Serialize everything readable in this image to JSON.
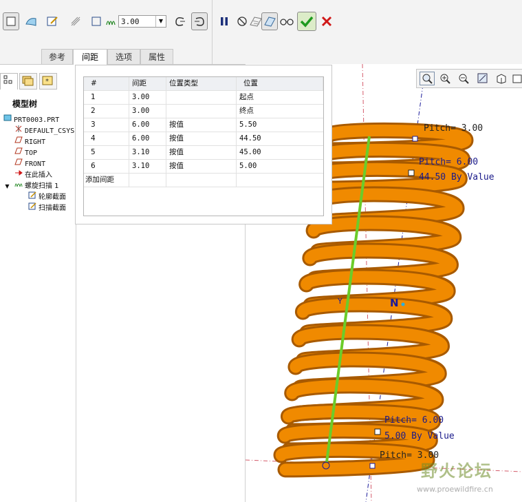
{
  "ribbon": {
    "pitch_value": "3.00",
    "tabs": [
      "参考",
      "间距",
      "选项",
      "属性"
    ],
    "active_tab": "间距"
  },
  "left_panel": {
    "tree_title": "模型树",
    "tree_items": [
      {
        "icon": "part-icon",
        "label": "PRT0003.PRT"
      },
      {
        "icon": "csys-icon",
        "label": "DEFAULT_CSYS"
      },
      {
        "icon": "datum-plane-icon",
        "label": "RIGHT"
      },
      {
        "icon": "datum-plane-icon",
        "label": "TOP"
      },
      {
        "icon": "datum-plane-icon",
        "label": "FRONT"
      },
      {
        "icon": "insert-arrow-icon",
        "label": "在此插入"
      },
      {
        "icon": "helical-sweep-icon",
        "label": "螺旋扫描 1"
      },
      {
        "icon": "sketch-icon",
        "label": "轮廓截面"
      },
      {
        "icon": "sketch-icon",
        "label": "扫描截面"
      }
    ]
  },
  "pitch_table": {
    "headers": [
      "#",
      "间距",
      "位置类型",
      "位置"
    ],
    "rows": [
      [
        "1",
        "3.00",
        "",
        "起点"
      ],
      [
        "2",
        "3.00",
        "",
        "终点"
      ],
      [
        "3",
        "6.00",
        "按值",
        "5.50"
      ],
      [
        "4",
        "6.00",
        "按值",
        "44.50"
      ],
      [
        "5",
        "3.10",
        "按值",
        "45.00"
      ],
      [
        "6",
        "3.10",
        "按值",
        "5.00"
      ]
    ],
    "add_row_label": "添加间距"
  },
  "graphics": {
    "labels": {
      "pitch_top": "Pitch= 3.00",
      "pitch_upper": "Pitch= 6.00",
      "by_value_upper": "44.50 By Value",
      "pitch_lower": "Pitch= 6.00",
      "by_value_lower": "5.00 By Value",
      "pitch_bottom": "Pitch= 3.00"
    },
    "spring_color": "#f08a00",
    "axis_color": "#1a1a9a"
  },
  "watermark": {
    "text": "野火论坛",
    "url": "www.proewildfire.cn"
  }
}
